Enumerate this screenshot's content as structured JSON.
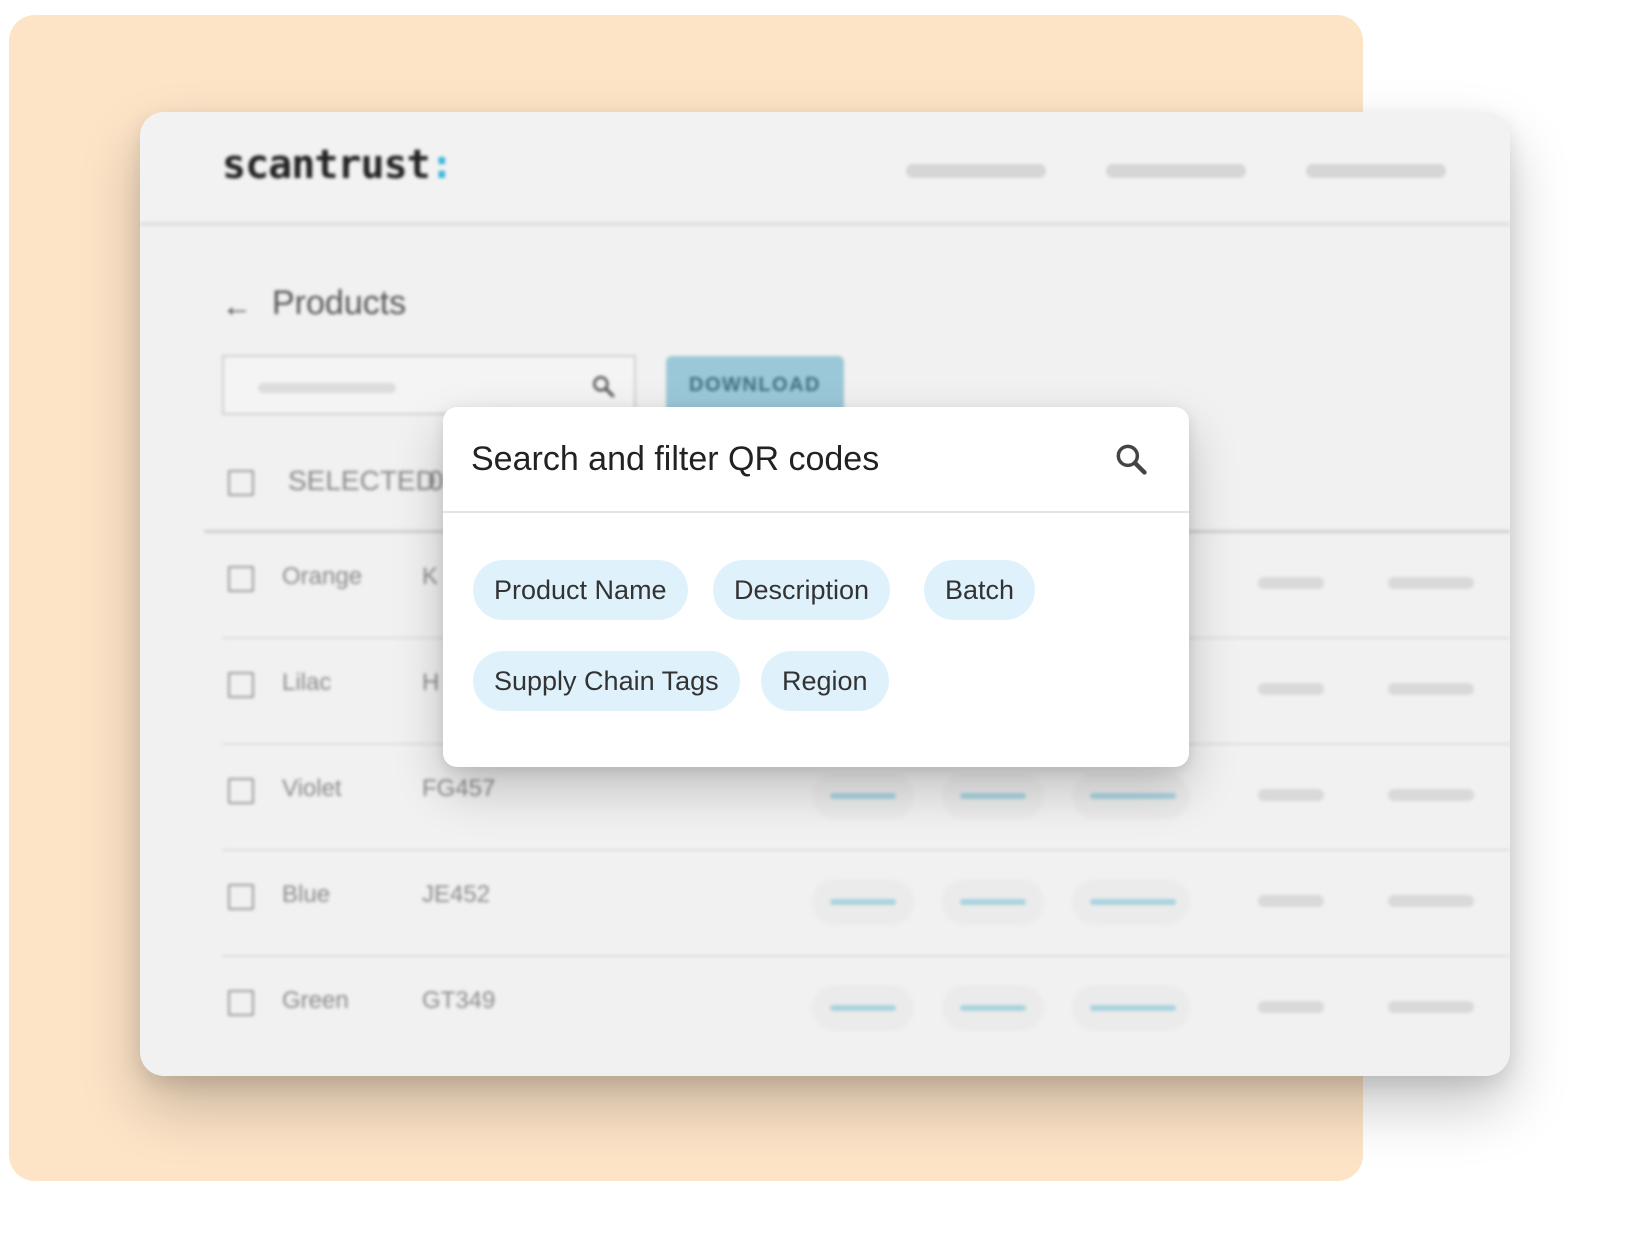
{
  "app": {
    "logo_text": "scantrust",
    "logo_dot": ":"
  },
  "page": {
    "title": "Products",
    "back_icon": "arrow-left-icon"
  },
  "toolbar": {
    "search_icon": "search-icon",
    "download_label": "DOWNLOAD"
  },
  "table": {
    "selected_label": "SELECTED",
    "selected_count": "0",
    "rows": [
      {
        "name": "Orange",
        "code": "K"
      },
      {
        "name": "Lilac",
        "code": "H"
      },
      {
        "name": "Violet",
        "code": "FG457"
      },
      {
        "name": "Blue",
        "code": "JE452"
      },
      {
        "name": "Green",
        "code": "GT349"
      }
    ]
  },
  "modal": {
    "title": "Search and filter QR codes",
    "search_icon": "search-icon",
    "chips": [
      "Product Name",
      "Description",
      "Batch",
      "Supply Chain Tags",
      "Region"
    ]
  },
  "colors": {
    "accent": "#3cb6dc",
    "backdrop": "#fde4c7",
    "chip_bg": "#dff2fc",
    "button": "#9bc8d8"
  }
}
